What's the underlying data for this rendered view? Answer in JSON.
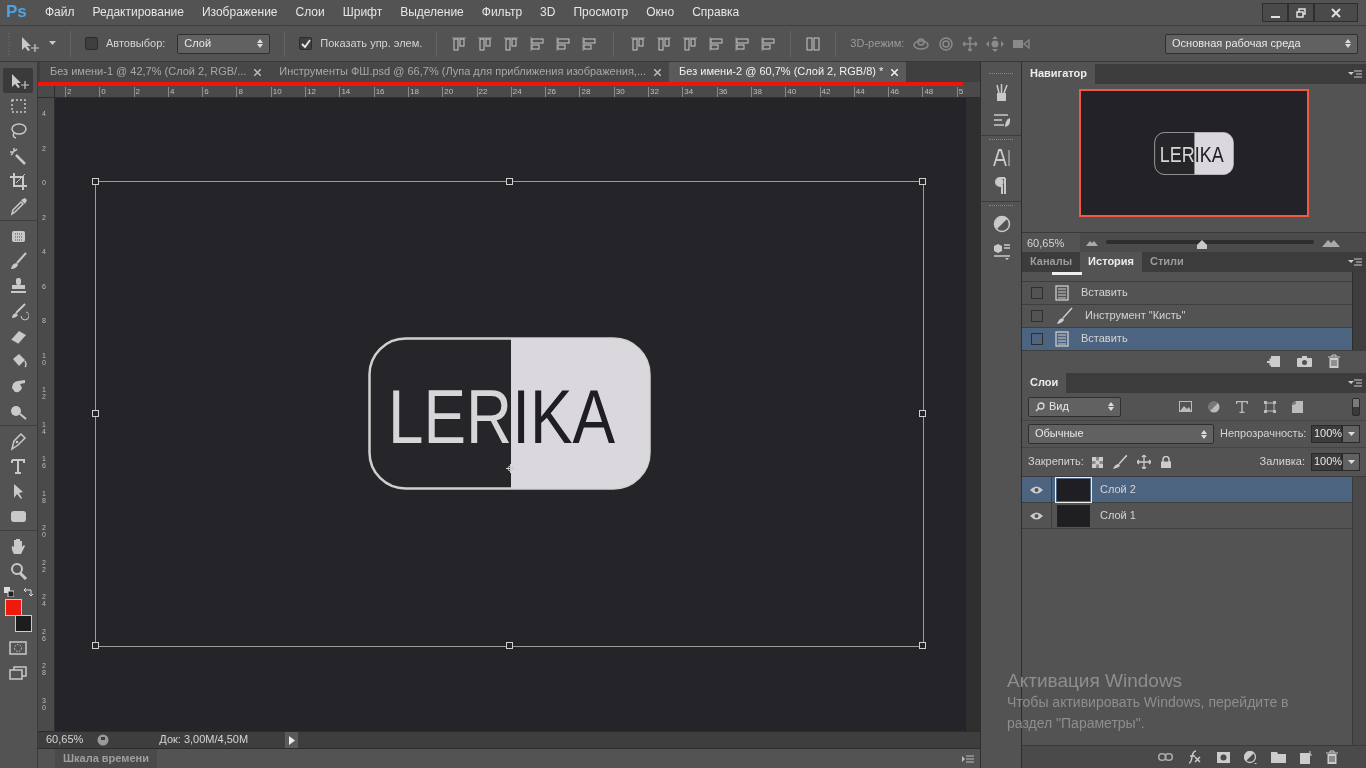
{
  "app_logo": "Ps",
  "menu": [
    "Файл",
    "Редактирование",
    "Изображение",
    "Слои",
    "Шрифт",
    "Выделение",
    "Фильтр",
    "3D",
    "Просмотр",
    "Окно",
    "Справка"
  ],
  "options_bar": {
    "auto_select": {
      "label": "Автовыбор:",
      "checked": false
    },
    "auto_select_target": "Слой",
    "show_controls": {
      "label": "Показать упр. элем.",
      "checked": true
    },
    "mode_3d_label": "3D-режим:",
    "workspace": "Основная рабочая среда"
  },
  "document_tabs": [
    {
      "title": "Без имени-1 @ 42,7% (Слой 2, RGB/...",
      "selected": false
    },
    {
      "title": "Инструменты ФШ.psd @ 66,7% (Лупа для приближения изображения,...",
      "selected": false
    },
    {
      "title": "Без имени-2 @ 60,7% (Слой 2, RGB/8) *",
      "selected": true
    }
  ],
  "rulers": {
    "horizontal": [
      "2",
      "0",
      "2",
      "4",
      "6",
      "8",
      "10",
      "12",
      "14",
      "16",
      "18",
      "20",
      "22",
      "24",
      "26",
      "28",
      "30",
      "32",
      "34",
      "36",
      "38",
      "40",
      "42",
      "44",
      "46",
      "48",
      "5"
    ],
    "vertical": [
      "4",
      "2",
      "0",
      "2",
      "4",
      "6",
      "8",
      "10",
      "12",
      "14",
      "16",
      "18",
      "20",
      "22",
      "24",
      "26",
      "28",
      "30"
    ]
  },
  "tools": [
    {
      "kind": "move",
      "selected": true
    },
    {
      "kind": "marquee",
      "selected": false
    },
    {
      "kind": "lasso",
      "selected": false
    },
    {
      "kind": "wand",
      "selected": false
    },
    {
      "kind": "crop",
      "selected": false
    },
    {
      "kind": "eyedropper",
      "selected": false
    },
    {
      "kind": "healing",
      "selected": false
    },
    {
      "kind": "brush",
      "selected": false
    },
    {
      "kind": "stamp",
      "selected": false
    },
    {
      "kind": "history",
      "selected": false
    },
    {
      "kind": "eraser",
      "selected": false
    },
    {
      "kind": "bucket",
      "selected": false
    },
    {
      "kind": "smudge",
      "selected": false
    },
    {
      "kind": "dodge",
      "selected": false
    },
    {
      "kind": "pen",
      "selected": false
    },
    {
      "kind": "type",
      "selected": false
    },
    {
      "kind": "path",
      "selected": false
    },
    {
      "kind": "shape",
      "selected": false
    },
    {
      "kind": "hand",
      "selected": false
    },
    {
      "kind": "zoom",
      "selected": false
    }
  ],
  "color_swatches": [
    {
      "kind": "foreground",
      "color": "#f01a0c"
    },
    {
      "kind": "background",
      "color": "#1d1c1f"
    }
  ],
  "canvas": {
    "logo_text": "LERIKA"
  },
  "status_bar": {
    "zoom": "60,65%",
    "doc_info": "Док: 3,00M/4,50M"
  },
  "timeline_tab": "Шкала времени",
  "navigator": {
    "title": "Навигатор",
    "logo_text": "LERIKA",
    "zoom": "60,65%",
    "level": 0.46
  },
  "history_panel": {
    "tabs": [
      {
        "label": "Каналы",
        "selected": false
      },
      {
        "label": "История",
        "selected": true
      },
      {
        "label": "Стили",
        "selected": false
      }
    ],
    "snapshot_row_partial": true,
    "items": [
      {
        "label": "Вставить",
        "kind": "document",
        "selected": false
      },
      {
        "label": "Инструмент \"Кисть\"",
        "kind": "brush",
        "selected": false
      },
      {
        "label": "Вставить",
        "kind": "document",
        "selected": true
      }
    ]
  },
  "layers_panel": {
    "title": "Слои",
    "filter": "Вид",
    "blend_mode": "Обычные",
    "opacity_label": "Непрозрачность:",
    "opacity": "100%",
    "lock_label": "Закрепить:",
    "fill_label": "Заливка:",
    "fill": "100%",
    "layers": [
      {
        "name": "Слой 2",
        "visible": true,
        "selected": true
      },
      {
        "name": "Слой 1",
        "visible": true,
        "selected": false
      }
    ]
  },
  "os_notice": {
    "title": "Активация Windows",
    "text": "Чтобы активировать Windows, перейдите в раздел \"Параметры\"."
  }
}
